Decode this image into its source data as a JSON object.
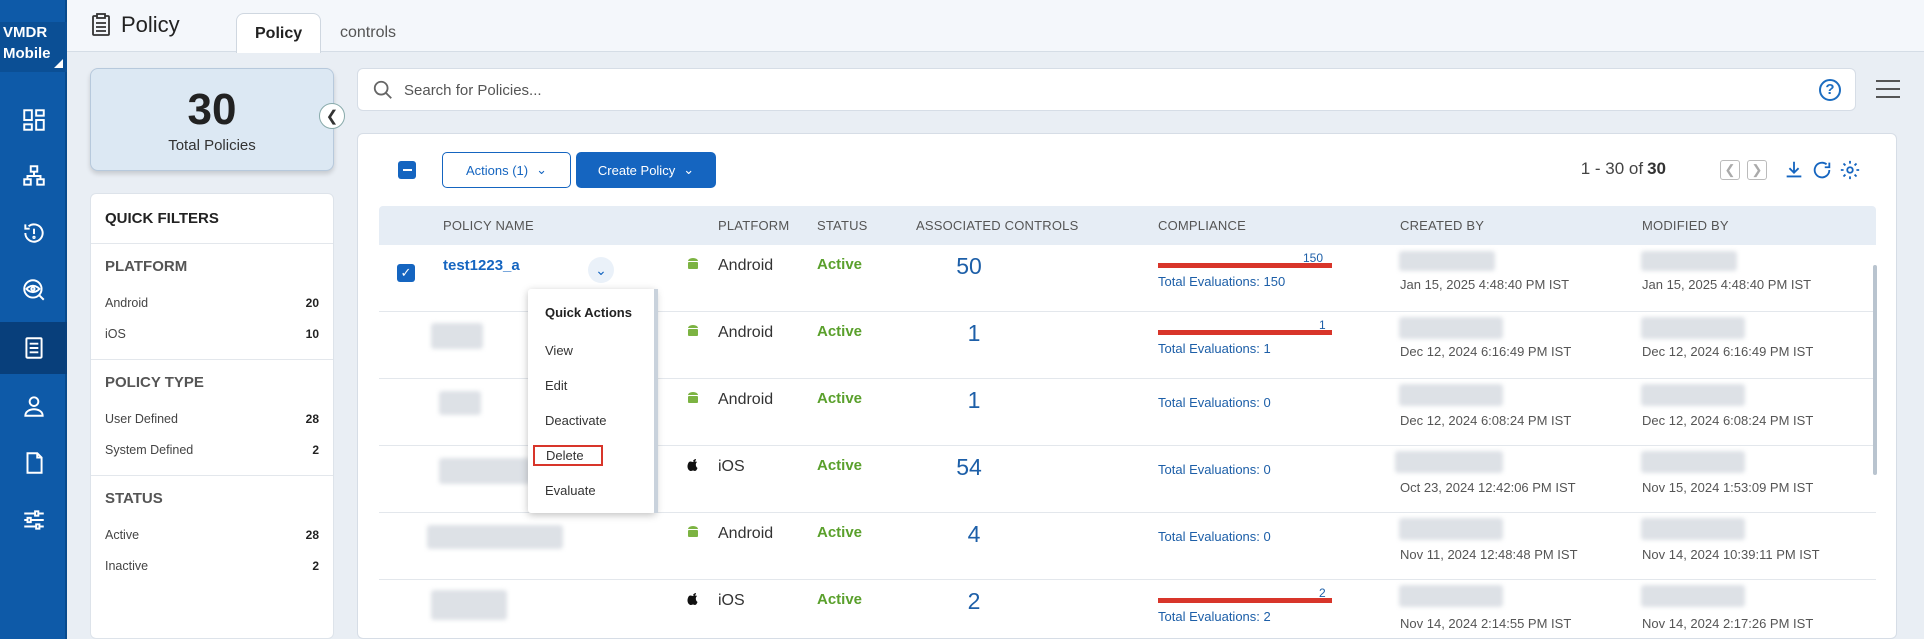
{
  "app": {
    "brand_line1": "VMDR",
    "brand_line2": "Mobile"
  },
  "nav": [
    "dashboard-icon",
    "inventory-icon",
    "history-icon",
    "detection-icon",
    "policy-icon",
    "user-icon",
    "report-icon",
    "settings-icon"
  ],
  "header": {
    "title": "Policy",
    "tabs": [
      {
        "label": "Policy",
        "active": true
      },
      {
        "label": "controls",
        "active": false
      }
    ]
  },
  "summary": {
    "total": "30",
    "label": "Total Policies"
  },
  "quick_filters": {
    "title": "QUICK FILTERS",
    "sections": [
      {
        "title": "PLATFORM",
        "items": [
          {
            "label": "Android",
            "count": "20"
          },
          {
            "label": "iOS",
            "count": "10"
          }
        ]
      },
      {
        "title": "POLICY TYPE",
        "items": [
          {
            "label": "User Defined",
            "count": "28"
          },
          {
            "label": "System Defined",
            "count": "2"
          }
        ]
      },
      {
        "title": "STATUS",
        "items": [
          {
            "label": "Active",
            "count": "28"
          },
          {
            "label": "Inactive",
            "count": "2"
          }
        ]
      }
    ]
  },
  "search": {
    "placeholder": "Search for Policies..."
  },
  "toolbar": {
    "actions_label": "Actions (1)",
    "create_label": "Create Policy",
    "pager_range": "1 - 30 of",
    "pager_total": "30"
  },
  "table": {
    "columns": [
      "POLICY NAME",
      "PLATFORM",
      "STATUS",
      "ASSOCIATED CONTROLS",
      "COMPLIANCE",
      "CREATED BY",
      "MODIFIED BY"
    ],
    "rows": [
      {
        "name": "test1223_a",
        "platform": "Android",
        "status": "Active",
        "controls": "50",
        "compliance_fail": "150",
        "total_evaluations": "Total Evaluations: 150",
        "created": "Jan 15, 2025 4:48:40 PM IST",
        "modified": "Jan 15, 2025 4:48:40 PM IST"
      },
      {
        "name": "",
        "platform": "Android",
        "status": "Active",
        "controls": "1",
        "compliance_fail": "1",
        "total_evaluations": "Total Evaluations: 1",
        "created": "Dec 12, 2024 6:16:49 PM IST",
        "modified": "Dec 12, 2024 6:16:49 PM IST"
      },
      {
        "name": "",
        "platform": "Android",
        "status": "Active",
        "controls": "1",
        "compliance_fail": "",
        "total_evaluations": "Total Evaluations: 0",
        "created": "Dec 12, 2024 6:08:24 PM IST",
        "modified": "Dec 12, 2024 6:08:24 PM IST"
      },
      {
        "name": "",
        "platform": "iOS",
        "status": "Active",
        "controls": "54",
        "compliance_fail": "",
        "total_evaluations": "Total Evaluations: 0",
        "created": "Oct 23, 2024 12:42:06 PM IST",
        "modified": "Nov 15, 2024 1:53:09 PM IST"
      },
      {
        "name": "",
        "platform": "Android",
        "status": "Active",
        "controls": "4",
        "compliance_fail": "",
        "total_evaluations": "Total Evaluations: 0",
        "created": "Nov 11, 2024 12:48:48 PM IST",
        "modified": "Nov 14, 2024 10:39:11 PM IST"
      },
      {
        "name": "",
        "platform": "iOS",
        "status": "Active",
        "controls": "2",
        "compliance_fail": "2",
        "total_evaluations": "Total Evaluations: 2",
        "created": "Nov 14, 2024 2:14:55 PM IST",
        "modified": "Nov 14, 2024 2:17:26 PM IST"
      }
    ]
  },
  "quick_actions": {
    "title": "Quick Actions",
    "items": [
      "View",
      "Edit",
      "Deactivate",
      "Delete",
      "Evaluate"
    ]
  },
  "colors": {
    "brand": "#0e5aa8",
    "accent": "#1565c0",
    "active_status": "#5aa02c",
    "fail_bar": "#d8352a"
  }
}
